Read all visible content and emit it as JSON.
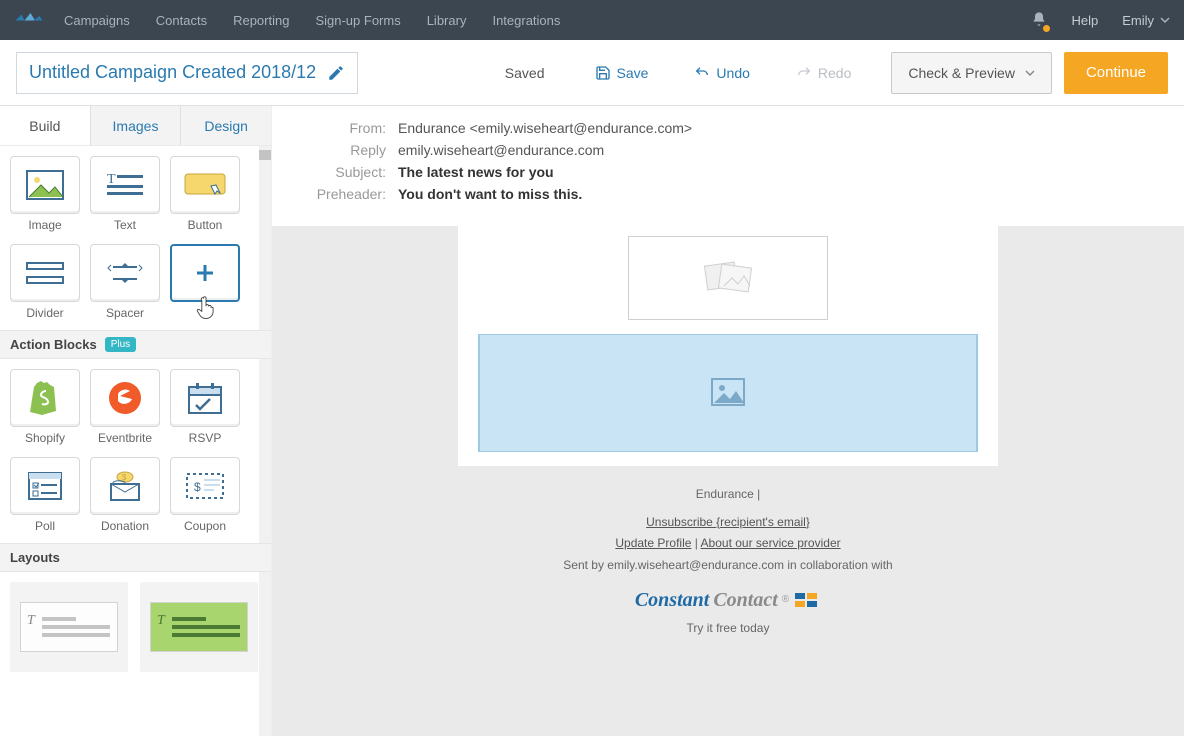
{
  "nav": {
    "items": [
      "Campaigns",
      "Contacts",
      "Reporting",
      "Sign-up Forms",
      "Library",
      "Integrations"
    ],
    "help": "Help",
    "user": "Emily"
  },
  "toolbar": {
    "title": "Untitled Campaign Created 2018/12",
    "saved": "Saved",
    "save": "Save",
    "undo": "Undo",
    "redo": "Redo",
    "check": "Check & Preview",
    "continue": "Continue"
  },
  "sidebar": {
    "tabs": {
      "build": "Build",
      "images": "Images",
      "design": "Design"
    },
    "blocks": {
      "image": "Image",
      "text": "Text",
      "button": "Button",
      "divider": "Divider",
      "spacer": "Spacer",
      "more": "More"
    },
    "action_header": "Action Blocks",
    "plus_badge": "Plus",
    "actions": {
      "shopify": "Shopify",
      "eventbrite": "Eventbrite",
      "rsvp": "RSVP",
      "poll": "Poll",
      "donation": "Donation",
      "coupon": "Coupon"
    },
    "layouts_header": "Layouts"
  },
  "meta": {
    "from_label": "From:",
    "from": "Endurance <emily.wiseheart@endurance.com>",
    "reply_label": "Reply",
    "reply": "emily.wiseheart@endurance.com",
    "subject_label": "Subject:",
    "subject": "The latest news for you",
    "preheader_label": "Preheader:",
    "preheader": "You don't want to miss this."
  },
  "footer": {
    "company": "Endurance",
    "pipe": " | ",
    "unsubscribe": "Unsubscribe {recipient's email}",
    "update": "Update Profile",
    "about": "About our service provider",
    "sent_by": "Sent by emily.wiseheart@endurance.com in collaboration with",
    "brand1": "Constant",
    "brand2": "Contact",
    "try": "Try it free today"
  }
}
